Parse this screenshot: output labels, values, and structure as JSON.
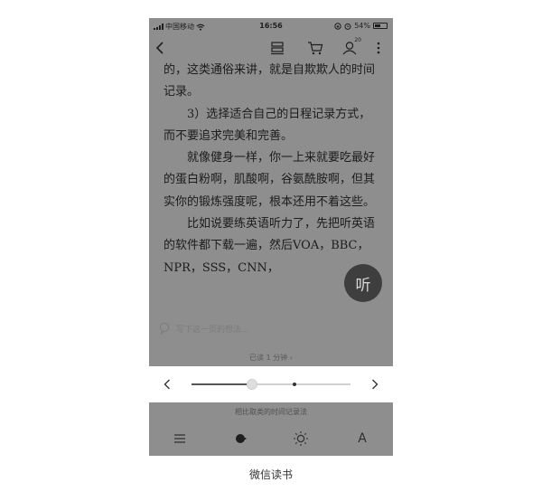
{
  "status_bar": {
    "carrier": "中国移动",
    "time": "16:56",
    "battery": "54%",
    "battery_level": 0.54
  },
  "topbar": {
    "notification_count": "20"
  },
  "reader": {
    "paragraphs": [
      {
        "text": "的，这类通俗来讲，就是自欺欺人的时间记录。",
        "indent": false
      },
      {
        "text": "3）选择适合自己的日程记录方式，而不要追求完美和完善。",
        "indent": true
      },
      {
        "text": "就像健身一样，你一上来就要吃最好的蛋白粉啊，肌酸啊，谷氨酰胺啊，但其实你的锻炼强度呢，根本还用不着这些。",
        "indent": true
      },
      {
        "text": "比如说要练英语听力了，先把听英语的软件都下载一遍，然后VOA，BBC，NPR，SSS，CNN，",
        "indent": true
      }
    ],
    "listen_label": "听",
    "thought_placeholder": "写下这一页的想法...",
    "read_time": "已读 1 分钟 ›",
    "chapter": "相比取类的时间记录法"
  },
  "progress": {
    "position": 0.38,
    "chapter_marker": 0.65
  },
  "caption": "微信读书",
  "colors": {
    "overlay_gray": "#8e8e8e",
    "panel_white": "#ffffff",
    "text_dark": "#1c1c1c"
  }
}
